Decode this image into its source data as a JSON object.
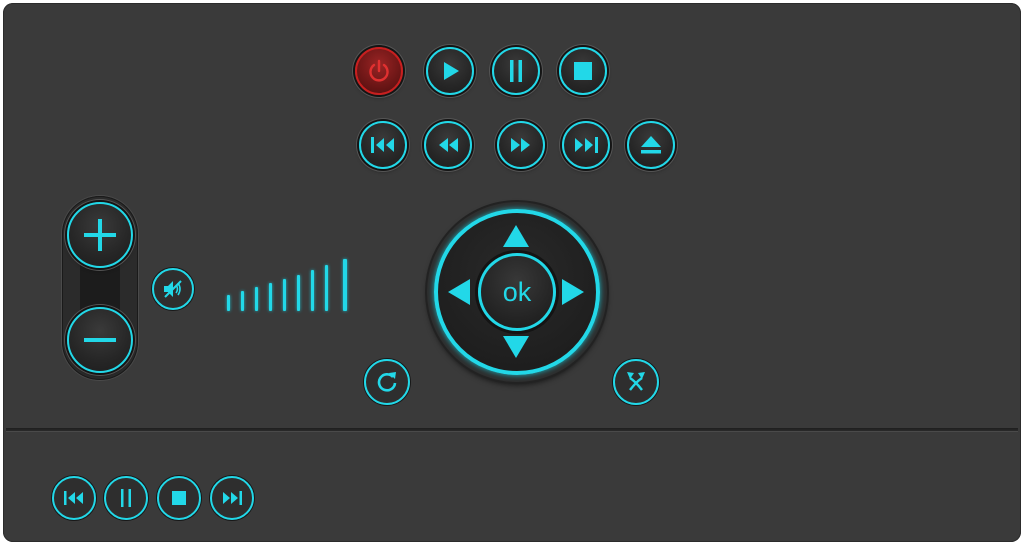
{
  "colors": {
    "accent": "#22d8e8",
    "power": "#c81f1f",
    "panel": "#3a3a3a"
  },
  "transport_top": [
    {
      "name": "power-button",
      "icon": "power-icon"
    },
    {
      "name": "play-button",
      "icon": "play-icon"
    },
    {
      "name": "pause-button",
      "icon": "pause-icon"
    },
    {
      "name": "stop-button",
      "icon": "stop-icon"
    }
  ],
  "transport_second": [
    {
      "name": "skip-previous-button",
      "icon": "skip-previous-icon"
    },
    {
      "name": "rewind-button",
      "icon": "rewind-icon"
    },
    {
      "name": "fast-forward-button",
      "icon": "fast-forward-icon"
    },
    {
      "name": "skip-next-button",
      "icon": "skip-next-icon"
    },
    {
      "name": "eject-button",
      "icon": "eject-icon"
    }
  ],
  "volume": {
    "up_icon": "plus-icon",
    "down_icon": "minus-icon",
    "mute_icon": "mute-icon",
    "level_bars": 9
  },
  "dpad": {
    "ok_label": "ok",
    "up_icon": "arrow-up-icon",
    "down_icon": "arrow-down-icon",
    "left_icon": "arrow-left-icon",
    "right_icon": "arrow-right-icon"
  },
  "extra": {
    "replay_icon": "replay-icon",
    "shuffle_icon": "shuffle-icon"
  },
  "mini_transport": [
    {
      "name": "mini-skip-previous-button",
      "icon": "skip-previous-icon"
    },
    {
      "name": "mini-pause-button",
      "icon": "pause-icon"
    },
    {
      "name": "mini-stop-button",
      "icon": "stop-icon"
    },
    {
      "name": "mini-skip-next-button",
      "icon": "skip-next-icon"
    }
  ]
}
